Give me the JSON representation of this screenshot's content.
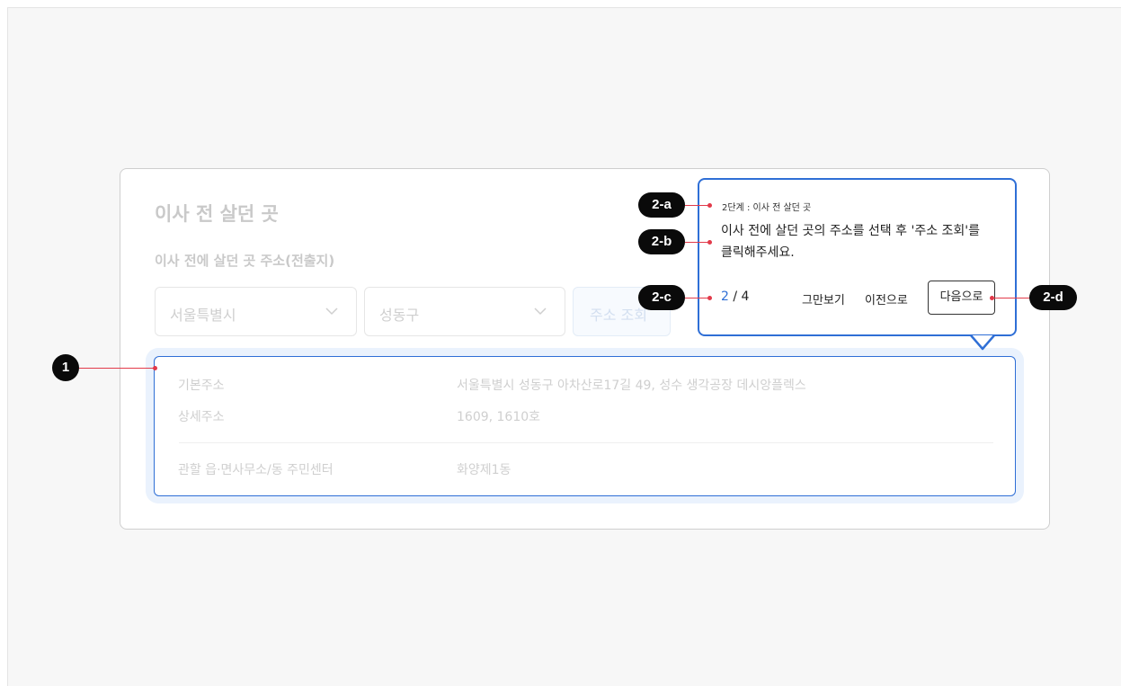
{
  "form": {
    "title": "이사 전 살던 곳",
    "subtitle": "이사 전에 살던 곳 주소(전출지)",
    "city_select": "서울특별시",
    "district_select": "성동구",
    "search_button": "주소 조회"
  },
  "result": {
    "rows": [
      {
        "label": "기본주소",
        "value": "서울특별시 성동구 아차산로17길 49, 성수 생각공장 데시앙플렉스"
      },
      {
        "label": "상세주소",
        "value": "1609, 1610호"
      },
      {
        "label": "관할 읍·면사무소/동 주민센터",
        "value": "화양제1동"
      }
    ]
  },
  "tooltip": {
    "step": "2단계 : 이사 전 살던 곳",
    "body": "이사 전에 살던 곳의 주소를 선택 후 '주소 조회'를 클릭해주세요.",
    "page_current": "2",
    "page_total": "/ 4",
    "stop": "그만보기",
    "prev": "이전으로",
    "next": "다음으로"
  },
  "annotations": {
    "one": "1",
    "a": "2-a",
    "b": "2-b",
    "c": "2-c",
    "d": "2-d"
  },
  "colors": {
    "accent": "#2f6fd6",
    "annotation_line": "#e23a4a",
    "badge": "#0a0a0a"
  }
}
